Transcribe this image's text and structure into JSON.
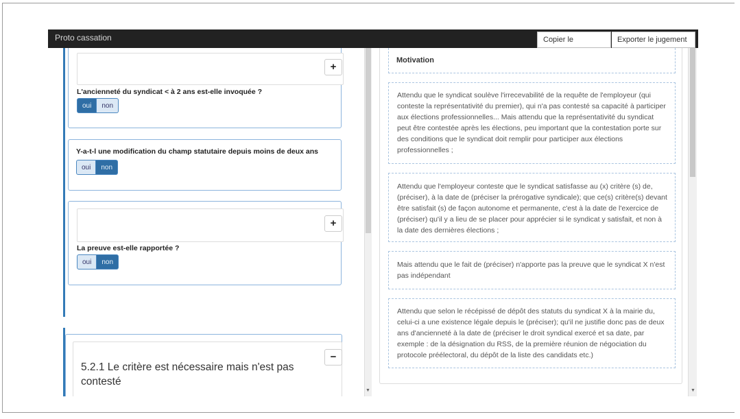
{
  "app": {
    "title": "Proto cassation",
    "copy_label": "Copier le jugement",
    "export_label": "Exporter le jugement"
  },
  "left": {
    "plus_icon": "+",
    "minus_icon": "−",
    "q1": {
      "text": "L'ancienneté du syndicat < à 2 ans est-elle invoquée ?",
      "yes": "oui",
      "no": "non",
      "selected": "oui"
    },
    "q2": {
      "text": "Y-a-t-l une modification du champ statutaire depuis moins de deux ans",
      "yes": "oui",
      "no": "non",
      "selected": "non"
    },
    "q3": {
      "text": "La preuve est-elle rapportée ?",
      "yes": "oui",
      "no": "non",
      "selected": "non"
    },
    "section": {
      "title": "5.2.1 Le critère est nécessaire mais n'est pas contesté"
    }
  },
  "right": {
    "heading": "Motivation",
    "paragraphs": [
      "Attendu que le syndicat soulève l'irrecevabilité de la requête de l'employeur (qui conteste la représentativité du premier), qui n'a pas contesté sa capacité à participer aux élections professionnelles... Mais attendu que la représentativité du syndicat peut être contestée après les élections, peu important que la contestation porte sur des conditions que le syndicat doit remplir pour participer aux élections professionnelles ;",
      "Attendu que l'employeur conteste que le syndicat satisfasse au (x) critère (s) de, (préciser), à la date de (préciser la prérogative syndicale); que ce(s) critère(s) devant être satisfait (s) de façon autonome et permanente, c'est à la date de l'exercice de (préciser) qu'il y a lieu de se placer pour apprécier si le syndicat y satisfait, et non à  la date des dernières élections ;",
      "Mais attendu que le fait de (préciser) n'apporte pas la preuve que le syndicat X n'est pas indépendant",
      "Attendu que selon le récépissé de dépôt des statuts du syndicat X à la mairie du, celui-ci a une existence légale depuis le (préciser); qu'il ne justifie donc pas de deux ans d'ancienneté à la date de (préciser le droit syndical exercé et sa date, par exemple : de la désignation du RSS, de la première réunion de négociation du protocole préélectoral, du dépôt de la liste des candidats etc.)"
    ]
  },
  "colors": {
    "primary": "#337ab7",
    "navbar": "#222222",
    "panel_border": "#8cb4dd"
  }
}
